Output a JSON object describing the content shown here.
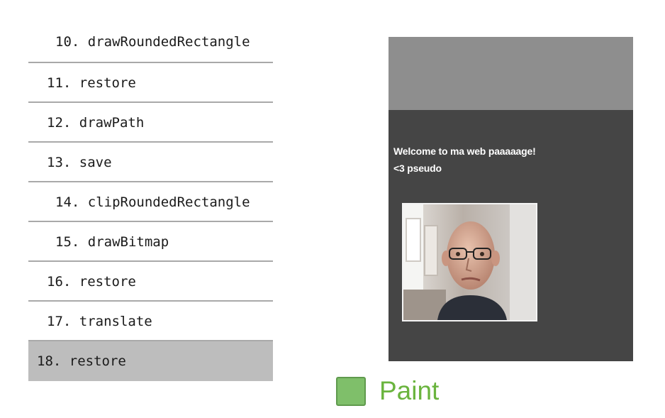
{
  "commands": [
    {
      "label": "10. drawRoundedRectangle"
    },
    {
      "label": "11. restore"
    },
    {
      "label": "12. drawPath"
    },
    {
      "label": "13. save"
    },
    {
      "label": "14. clipRoundedRectangle"
    },
    {
      "label": "15. drawBitmap"
    },
    {
      "label": "16. restore"
    },
    {
      "label": "17. translate"
    },
    {
      "label": "18. restore"
    }
  ],
  "preview": {
    "line1": "Welcome to ma web paaaaage!",
    "line2": "<3 pseudo"
  },
  "legend": {
    "label": "Paint",
    "color": "#7fbf6a"
  },
  "colors": {
    "highlight": "#bdbdbd",
    "page_bg": "#454545",
    "header_bg": "#8e8e8e",
    "paint_text": "#6ab43e"
  }
}
